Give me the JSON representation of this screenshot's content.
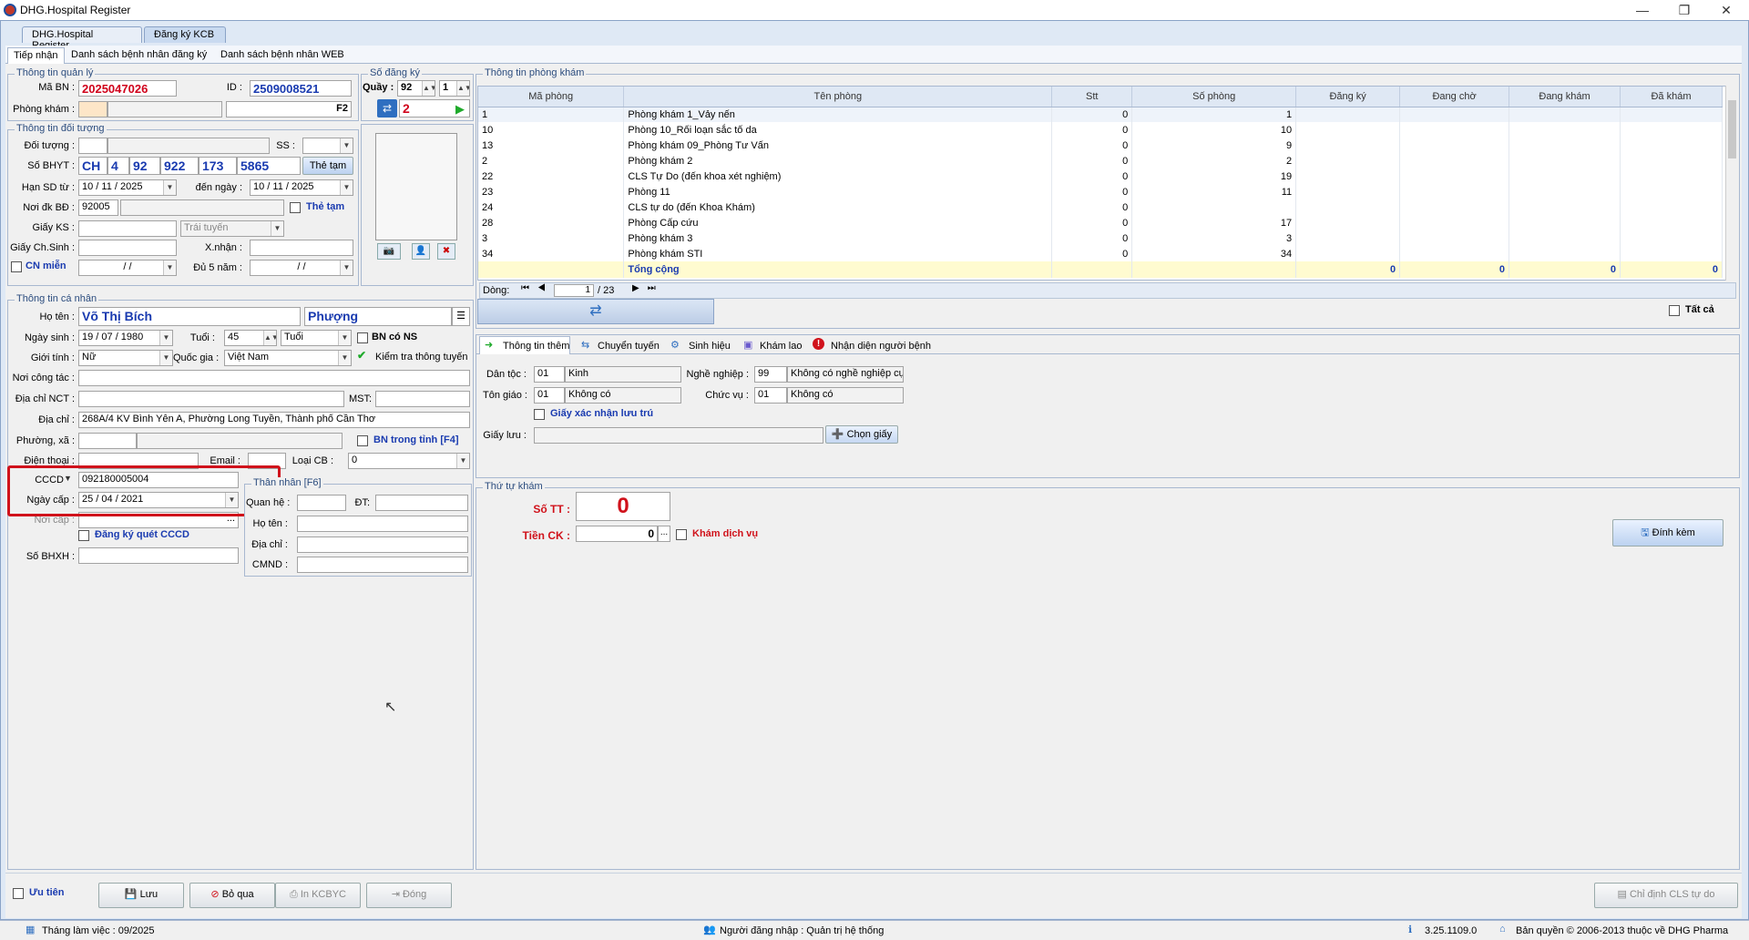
{
  "window": {
    "title": "DHG.Hospital Register"
  },
  "main_tabs": [
    "DHG.Hospital Register",
    "Đăng ký KCB"
  ],
  "sub_tabs": [
    "Tiếp nhận",
    "Danh sách bệnh nhân đăng ký",
    "Danh sách bệnh nhân WEB"
  ],
  "quan_ly": {
    "title": "Thông tin quản lý",
    "ma_bn_label": "Mã BN :",
    "ma_bn": "2025047026",
    "id_label": "ID :",
    "id": "2509008521",
    "phong_kham_label": "Phòng khám :",
    "f2": "F2"
  },
  "so_dang_ky": {
    "title": "Số đăng ký",
    "quay_label": "Quầy :",
    "quay": "92",
    "quay2": "1",
    "so": "2"
  },
  "doi_tuong": {
    "title": "Thông tin đối tượng",
    "doi_tuong_label": "Đối tượng :",
    "ss_label": "SS :",
    "bhyt_label": "Số BHYT :",
    "bhyt": [
      "CH",
      "4",
      "92",
      "922",
      "173",
      "5865"
    ],
    "the_tam_btn": "Thẻ tạm",
    "han_sd_label": "Hạn SD từ :",
    "han_tu": "10 / 11 / 2025",
    "den_ngay_label": "đến ngày :",
    "han_den": "10 / 11 / 2025",
    "noi_dk_label": "Nơi đk BĐ :",
    "noi_dk": "92005",
    "the_tam_chk": "Thẻ tạm",
    "giay_ks_label": "Giấy KS :",
    "trai_tuyen": "Trái tuyến",
    "giay_chsinh_label": "Giấy Ch.Sinh :",
    "xnhan_label": "X.nhận :",
    "cn_mien": "CN miễn",
    "cn_mien_date": " /  / ",
    "du5nam_label": "Đủ 5 năm :",
    "du5nam_date": " /  / "
  },
  "ca_nhan": {
    "title": "Thông tin cá nhân",
    "ho_ten_label": "Họ tên :",
    "ho_ten": "Võ Thị Bích",
    "ten": "Phượng",
    "ngay_sinh_label": "Ngày sinh :",
    "ngay_sinh": "19 / 07 / 1980",
    "tuoi_label": "Tuổi :",
    "tuoi": "45",
    "tuoi_unit": "Tuổi",
    "bn_co_ns": "BN có NS",
    "gioi_tinh_label": "Giới tính :",
    "gioi_tinh": "Nữ",
    "quoc_gia_label": "Quốc gia :",
    "quoc_gia": "Việt Nam",
    "kiem_tra": "Kiểm tra thông tuyến",
    "noi_cong_tac_label": "Nơi công tác :",
    "dia_chi_nct_label": "Địa chỉ  NCT :",
    "mst_label": "MST:",
    "dia_chi_label": "Địa chỉ :",
    "dia_chi": "268A/4 KV Bình Yên A, Phường Long Tuyền, Thành phố Cần Thơ",
    "phuong_label": "Phường, xã :",
    "bn_trong_tinh": "BN trong tỉnh [F4]",
    "dien_thoai_label": "Điện thoại :",
    "email_label": "Email :",
    "loai_cb_label": "Loại CB :",
    "loai_cb": "0",
    "cccd_label": "CCCD",
    "cccd": "092180005004",
    "ngay_cap_label": "Ngày cấp :",
    "ngay_cap": "25 / 04 / 2021",
    "noi_cap_label": "Nơi cấp :",
    "dang_ky_quet": "Đăng ký quét CCCD",
    "so_bhxh_label": "Số BHXH :"
  },
  "than_nhan": {
    "title": "Thân nhân [F6]",
    "quan_he_label": "Quan hệ :",
    "dt_label": "ĐT:",
    "ho_ten_label": "Họ tên :",
    "dia_chi_label": "Địa chỉ :",
    "cmnd_label": "CMND :"
  },
  "phong_kham": {
    "title": "Thông tin phòng khám",
    "columns": [
      "Mã phòng",
      "Tên phòng",
      "Stt",
      "Số phòng",
      "Đăng ký",
      "Đang chờ",
      "Đang khám",
      "Đã khám"
    ],
    "rows": [
      [
        "1",
        "Phòng khám 1_Vảy nến",
        "0",
        "1"
      ],
      [
        "10",
        "Phòng 10_Rối loạn sắc tố da",
        "0",
        "10"
      ],
      [
        "13",
        "Phòng khám 09_Phòng Tư Vấn",
        "0",
        "9"
      ],
      [
        "2",
        "Phòng khám 2",
        "0",
        "2"
      ],
      [
        "22",
        "CLS Tự Do (đến khoa xét nghiệm)",
        "0",
        "19"
      ],
      [
        "23",
        "Phòng 11",
        "0",
        "11"
      ],
      [
        "24",
        "CLS tự do (đến Khoa Khám)",
        "0",
        ""
      ],
      [
        "28",
        "Phòng Cấp cứu",
        "0",
        "17"
      ],
      [
        "3",
        "Phòng khám 3",
        "0",
        "3"
      ],
      [
        "34",
        "Phòng khám STI",
        "0",
        "34"
      ]
    ],
    "total_label": "Tổng cộng",
    "totals": [
      "0",
      "0",
      "0",
      "0"
    ],
    "dong_label": "Dòng:",
    "page": "1",
    "page_total": "/  23",
    "tat_ca": "Tất cả"
  },
  "info_tabs": [
    "Thông tin thêm",
    "Chuyển tuyến",
    "Sinh hiệu",
    "Khám lao",
    "Nhận diện người bệnh"
  ],
  "thong_tin_them": {
    "dan_toc_label": "Dân tộc :",
    "dan_toc_code": "01",
    "dan_toc": "Kinh",
    "nghe_nghiep_label": "Nghề nghiệp :",
    "nghe_code": "99",
    "nghe": "Không có nghề nghiệp cụ",
    "ton_giao_label": "Tôn giáo :",
    "ton_giao_code": "01",
    "ton_giao": "Không có",
    "chuc_vu_label": "Chức vụ :",
    "chuc_vu_code": "01",
    "chuc_vu": "Không có",
    "giay_xac_nhan": "Giấy xác nhận lưu trú",
    "giay_luu_label": "Giấy lưu :",
    "chon_giay": "Chọn giấy"
  },
  "thu_tu": {
    "title": "Thứ tự khám",
    "so_tt_label": "Số TT :",
    "so_tt": "0",
    "tien_ck_label": "Tiền CK :",
    "tien_ck": "0",
    "kham_dv": "Khám dịch vụ",
    "dinh_kem": "Đính kèm"
  },
  "footer": {
    "uu_tien": "Ưu tiên",
    "luu": "Lưu",
    "bo_qua": "Bỏ qua",
    "in": "In KCBYC",
    "dong": "Đóng",
    "chi_dinh": "Chỉ định CLS tự do"
  },
  "status": {
    "thang": "Tháng làm việc : 09/2025",
    "nguoi": "Người đăng nhập : Quản trị hệ thống",
    "version": "3.25.1109.0",
    "copyright": "Bản quyền © 2006-2013 thuộc về DHG Pharma"
  },
  "colors": {
    "accent": "#1a3bb0",
    "alert": "#d0121b"
  }
}
